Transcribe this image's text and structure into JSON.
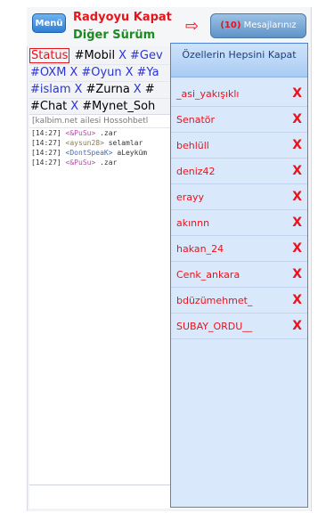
{
  "header": {
    "menu_label": "Menü",
    "radio_label": "Radyoyu Kapat",
    "version_label": "Diğer Sürüm",
    "arrow_glyph": "⇨",
    "messages_count": "(10)",
    "messages_label": "Mesajlarınız"
  },
  "tabs": {
    "close_glyph": "X",
    "rows": [
      [
        {
          "label": "Status",
          "style": "status"
        },
        {
          "label": "#Mobil",
          "style": "plain"
        },
        {
          "label": "#Gev",
          "style": "blue"
        }
      ],
      [
        {
          "label": "#OXM",
          "style": "blue"
        },
        {
          "label": "#Oyun",
          "style": "blue"
        },
        {
          "label": "#Ya",
          "style": "blue"
        }
      ],
      [
        {
          "label": "#islam",
          "style": "blue"
        },
        {
          "label": "#Zurna",
          "style": "plain"
        },
        {
          "label": "#",
          "style": "plain"
        }
      ],
      [
        {
          "label": "#Chat",
          "style": "plain"
        },
        {
          "label": "#Mynet_Soh",
          "style": "plain"
        }
      ]
    ]
  },
  "chat": {
    "topic": "[kalbim.net ailesi Hossohbetl",
    "lines": [
      {
        "time": "[14:27]",
        "nick": "<&PuSu>",
        "text": ".zar",
        "nickclass": "nick"
      },
      {
        "time": "[14:27]",
        "nick": "<aysun28>",
        "text": "selamlar",
        "nickclass": "nick2"
      },
      {
        "time": "[14:27]",
        "nick": "<DontSpeaK>",
        "text": "aLeyküm",
        "nickclass": "nick3"
      },
      {
        "time": "[14:27]",
        "nick": "<&PuSu>",
        "text": ".zar",
        "nickclass": "nick"
      }
    ]
  },
  "pm_panel": {
    "title": "Özellerin Hepsini Kapat",
    "close_glyph": "X",
    "items": [
      "_asi_yakışıklı",
      "Senatör",
      "behlüll",
      "deniz42",
      "erayy",
      "akınnn",
      "hakan_24",
      "Cenk_ankara",
      "bdüzümehmet_",
      "SUBAY_ORDU__"
    ]
  },
  "colors": {
    "accent_red": "#e8141b",
    "accent_green": "#1b8a1f",
    "link_blue": "#2b35d6",
    "panel_bg": "#d9e8fb"
  }
}
